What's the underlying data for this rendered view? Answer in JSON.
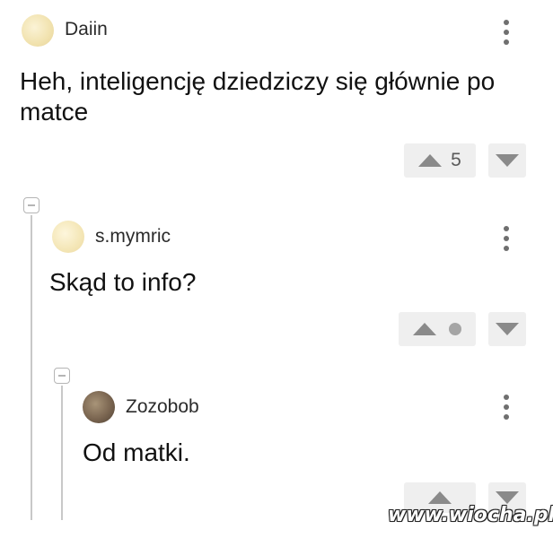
{
  "comments": [
    {
      "username": "Daiin",
      "text": "Heh, inteligencję dziedziczy się głównie po matce",
      "votes": "5",
      "menu_icon": "more-vertical-icon",
      "upvote_icon": "triangle-up-icon",
      "downvote_icon": "triangle-down-icon"
    },
    {
      "username": "s.mymric",
      "text": "Skąd to info?",
      "votes_indicator": "dot",
      "menu_icon": "more-vertical-icon",
      "collapse_icon": "minus-square-icon"
    },
    {
      "username": "Zozobob",
      "text": "Od matki.",
      "menu_icon": "more-vertical-icon",
      "collapse_icon": "minus-square-icon"
    }
  ],
  "watermark": "www.wiocha.pl",
  "colors": {
    "vote_bg": "#efefef",
    "icon_gray": "#8a8a8a",
    "thread_line": "#c8c8c8"
  }
}
